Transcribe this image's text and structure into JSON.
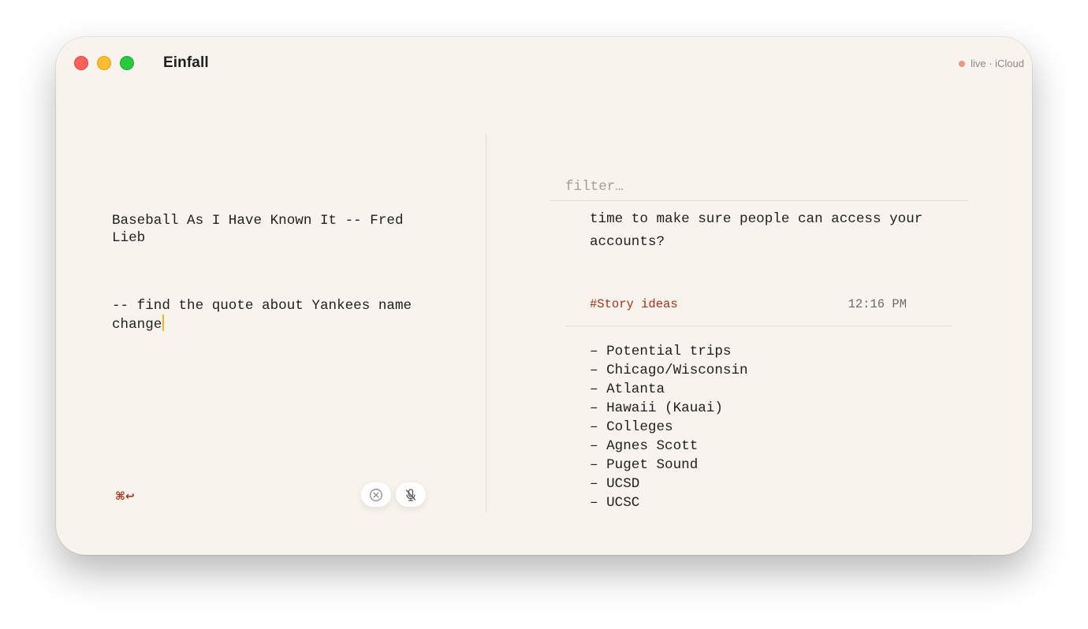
{
  "window": {
    "title": "Einfall",
    "status": {
      "text": "live · iCloud",
      "dot_color": "#e59a83"
    }
  },
  "editor": {
    "lines": [
      "Baseball As I Have Known It -- Fred Lieb",
      "-- find the quote about Yankees name change"
    ],
    "shortcut_hint": "⌘↩",
    "buttons": {
      "clear_icon": "x-circle-icon",
      "mic_icon": "mic-off-icon"
    }
  },
  "notes": {
    "filter": {
      "placeholder": "filter…",
      "value": ""
    },
    "previous_note_text": "time to make sure people can access your accounts?",
    "note": {
      "tag": "#Story ideas",
      "time": "12:16 PM",
      "items": [
        "– Potential trips",
        "– Chicago/Wisconsin",
        "– Atlanta",
        "– Hawaii (Kauai)",
        "– Colleges",
        "– Agnes Scott",
        "– Puget Sound",
        "– UCSD",
        "– UCSC"
      ]
    }
  },
  "colors": {
    "background": "#f8f4ed",
    "accent": "#a3331a",
    "caret": "#f0b429"
  }
}
